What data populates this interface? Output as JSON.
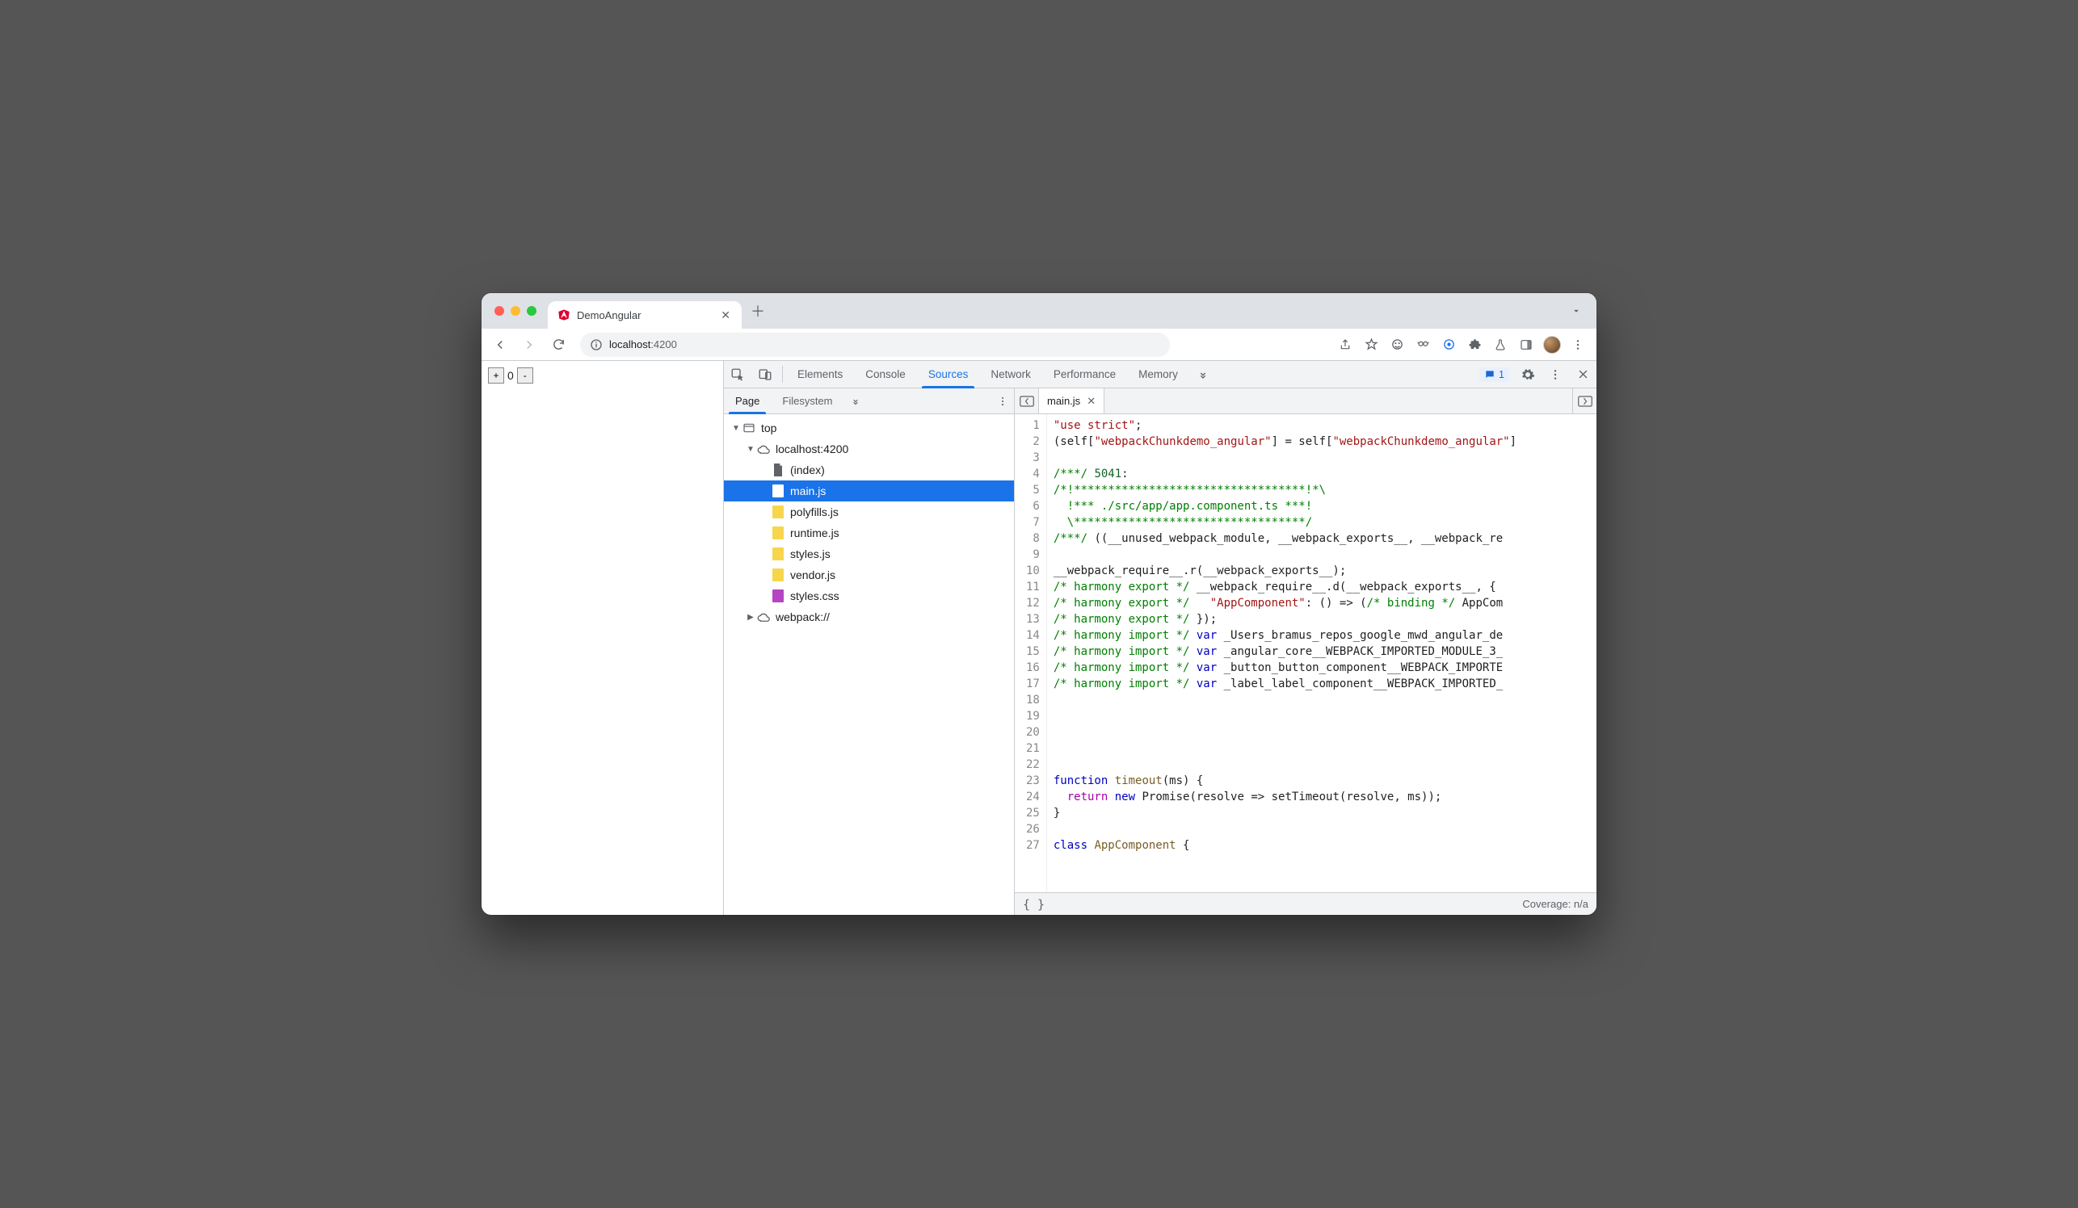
{
  "browser": {
    "tab_title": "DemoAngular",
    "url_host": "localhost",
    "url_port": ":4200"
  },
  "page": {
    "counter_value": "0"
  },
  "devtools": {
    "tabs": [
      "Elements",
      "Console",
      "Sources",
      "Network",
      "Performance",
      "Memory"
    ],
    "active_tab": "Sources",
    "issues_count": "1"
  },
  "sources_nav": {
    "tabs": [
      "Page",
      "Filesystem"
    ],
    "active": "Page",
    "tree": {
      "top": "top",
      "origin": "localhost:4200",
      "files": [
        {
          "name": "(index)",
          "kind": "doc"
        },
        {
          "name": "main.js",
          "kind": "js",
          "selected": true
        },
        {
          "name": "polyfills.js",
          "kind": "js"
        },
        {
          "name": "runtime.js",
          "kind": "js"
        },
        {
          "name": "styles.js",
          "kind": "js"
        },
        {
          "name": "vendor.js",
          "kind": "js"
        },
        {
          "name": "styles.css",
          "kind": "css"
        }
      ],
      "webpack": "webpack://"
    }
  },
  "editor": {
    "open_file": "main.js",
    "coverage": "Coverage: n/a",
    "lines": [
      {
        "n": 1,
        "html": "<span class='str'>\"use strict\"</span>;"
      },
      {
        "n": 2,
        "html": "(self[<span class='str'>\"webpackChunkdemo_angular\"</span>] = self[<span class='str'>\"webpackChunkdemo_angular\"</span>]"
      },
      {
        "n": 3,
        "html": ""
      },
      {
        "n": 4,
        "html": "<span class='cmt'>/***/</span> <span class='num'>5041</span>:"
      },
      {
        "n": 5,
        "html": "<span class='cmt'>/*!**********************************!*\\</span>"
      },
      {
        "n": 6,
        "html": "<span class='cmt'>  !*** ./src/app/app.component.ts ***!</span>"
      },
      {
        "n": 7,
        "html": "<span class='cmt'>  \\**********************************/</span>"
      },
      {
        "n": 8,
        "html": "<span class='cmt'>/***/</span> ((__unused_webpack_module, __webpack_exports__, __webpack_re"
      },
      {
        "n": 9,
        "html": ""
      },
      {
        "n": 10,
        "html": "__webpack_require__.r(__webpack_exports__);"
      },
      {
        "n": 11,
        "html": "<span class='cmt'>/* harmony export */</span> __webpack_require__.d(__webpack_exports__, {"
      },
      {
        "n": 12,
        "html": "<span class='cmt'>/* harmony export */</span>   <span class='str'>\"AppComponent\"</span>: () =&gt; (<span class='cmt'>/* binding */</span> AppCom"
      },
      {
        "n": 13,
        "html": "<span class='cmt'>/* harmony export */</span> });"
      },
      {
        "n": 14,
        "html": "<span class='cmt'>/* harmony import */</span> <span class='kw'>var</span> _Users_bramus_repos_google_mwd_angular_de"
      },
      {
        "n": 15,
        "html": "<span class='cmt'>/* harmony import */</span> <span class='kw'>var</span> _angular_core__WEBPACK_IMPORTED_MODULE_3_"
      },
      {
        "n": 16,
        "html": "<span class='cmt'>/* harmony import */</span> <span class='kw'>var</span> _button_button_component__WEBPACK_IMPORTE"
      },
      {
        "n": 17,
        "html": "<span class='cmt'>/* harmony import */</span> <span class='kw'>var</span> _label_label_component__WEBPACK_IMPORTED_"
      },
      {
        "n": 18,
        "html": ""
      },
      {
        "n": 19,
        "html": ""
      },
      {
        "n": 20,
        "html": ""
      },
      {
        "n": 21,
        "html": ""
      },
      {
        "n": 22,
        "html": ""
      },
      {
        "n": 23,
        "html": "<span class='kw'>function</span> <span class='fn'>timeout</span>(ms) {"
      },
      {
        "n": 24,
        "html": "  <span class='kw2'>return</span> <span class='kw'>new</span> Promise(resolve =&gt; setTimeout(resolve, ms));"
      },
      {
        "n": 25,
        "html": "}"
      },
      {
        "n": 26,
        "html": ""
      },
      {
        "n": 27,
        "html": "<span class='kw'>class</span> <span class='fn'>AppComponent</span> {"
      }
    ]
  }
}
